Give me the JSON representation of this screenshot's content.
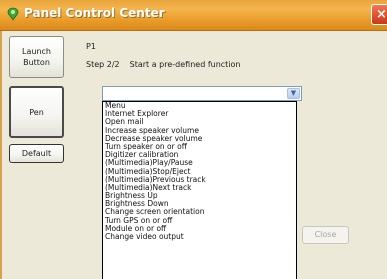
{
  "window": {
    "title": "Panel Control Center",
    "close_glyph": "×",
    "accent_color": "#e99a28"
  },
  "buttons": {
    "launch": "Launch Button",
    "pen": "Pen",
    "default": "Default",
    "close": "Close"
  },
  "panel": {
    "p_label": "P1",
    "step": "Step 2/2",
    "step_desc": "Start a pre-defined function"
  },
  "combo": {
    "selected": "",
    "arrow_icon": "chevron-down-icon"
  },
  "dropdown_items": [
    "Menu",
    "Internet Explorer",
    "Open mail",
    "Increase speaker volume",
    "Decrease speaker volume",
    "Turn speaker on or off",
    "Digitizer calibration",
    "(Multimedia)Play/Pause",
    "(Multimedia)Stop/Eject",
    "(Multimedia)Previous track",
    "(Multimedia)Next track",
    "Brightness Up",
    "Brightness Down",
    "Change screen orientation",
    "Turn GPS on or off",
    "Module on or off",
    "Change video output"
  ]
}
